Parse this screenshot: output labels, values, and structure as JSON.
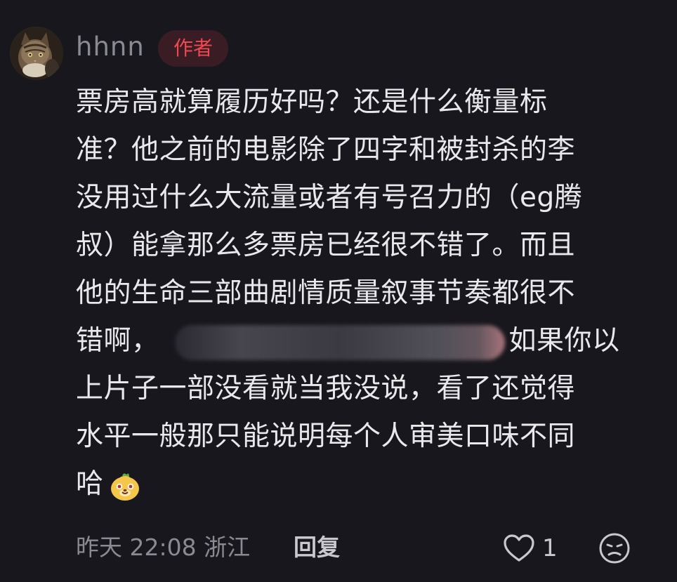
{
  "comment": {
    "username": "hhnn",
    "badge": "作者",
    "lines": {
      "l1": "票房高就算履历好吗？还是什么衡量标",
      "l2": "准？他之前的电影除了四字和被封杀的李",
      "l3": "没用过什么大流量或者有号召力的（eg腾",
      "l4": "叔）能拿那么多票房已经很不错了。而且",
      "l5": "他的生命三部曲剧情质量叙事节奏都很不",
      "l6a": "错啊，",
      "l6b": "如果你以",
      "l7": "上片子一部没看就当我没说，看了还觉得",
      "l8": "水平一般那只能说明每个人审美口味不同",
      "l9": "哈"
    },
    "footer": {
      "time_location": "昨天 22:08 浙江",
      "reply_label": "回复",
      "like_count": "1"
    },
    "icons": {
      "avatar": "cat-avatar",
      "emoji": "bear-face-emoji-icon",
      "like": "heart-icon",
      "dislike": "sad-face-icon"
    },
    "colors": {
      "background": "#18171d",
      "badge_text": "#f0484f",
      "badge_bg": "#3a1d24",
      "text": "#e9e9ec",
      "muted": "#8a8a93"
    }
  }
}
